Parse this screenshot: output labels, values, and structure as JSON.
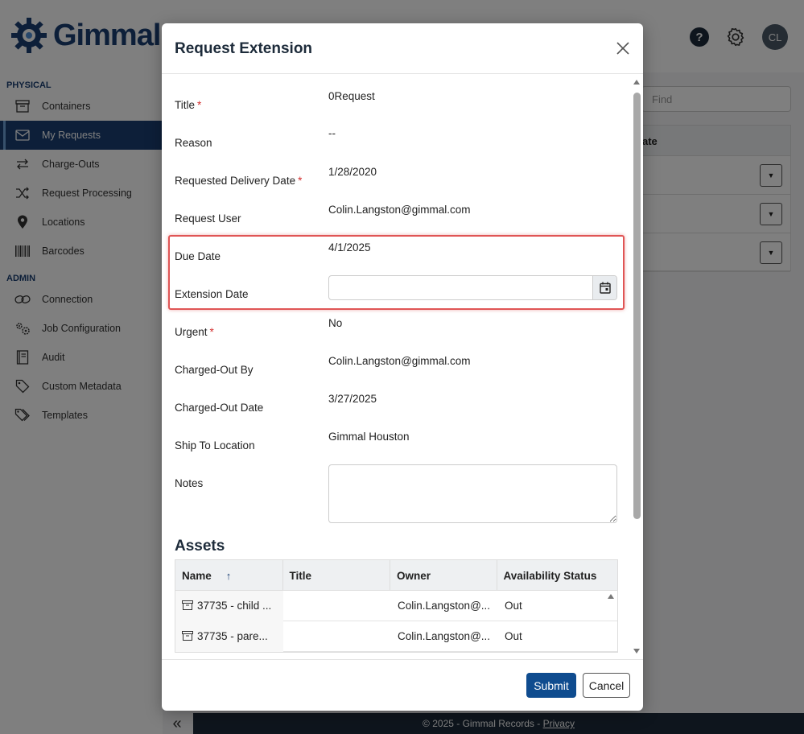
{
  "app": {
    "brand": "Gimmal",
    "avatar_initials": "CL",
    "help_label": "?",
    "find_placeholder": "Find",
    "bg_table_header": "ate",
    "footer_text": "© 2025 - Gimmal Records - ",
    "footer_link": "Privacy",
    "collapse_glyph": "«"
  },
  "sidebar": {
    "sections": [
      {
        "title": "PHYSICAL",
        "items": [
          {
            "label": "Containers",
            "icon": "archive-icon"
          },
          {
            "label": "My Requests",
            "icon": "mail-icon",
            "active": true
          },
          {
            "label": "Charge-Outs",
            "icon": "swap-icon"
          },
          {
            "label": "Request Processing",
            "icon": "shuffle-icon"
          },
          {
            "label": "Locations",
            "icon": "map-pin-icon"
          },
          {
            "label": "Barcodes",
            "icon": "barcode-icon"
          }
        ]
      },
      {
        "title": "ADMIN",
        "items": [
          {
            "label": "Connection",
            "icon": "link-icon"
          },
          {
            "label": "Job Configuration",
            "icon": "gears-icon"
          },
          {
            "label": "Audit",
            "icon": "book-icon"
          },
          {
            "label": "Custom Metadata",
            "icon": "tag-icon"
          },
          {
            "label": "Templates",
            "icon": "tags-icon"
          }
        ]
      }
    ]
  },
  "modal": {
    "title": "Request Extension",
    "fields": {
      "title_label": "Title",
      "title_value": "0Request",
      "reason_label": "Reason",
      "reason_value": "--",
      "delivery_label": "Requested Delivery Date",
      "delivery_value": "1/28/2020",
      "user_label": "Request User",
      "user_value": "Colin.Langston@gimmal.com",
      "due_label": "Due Date",
      "due_value": "4/1/2025",
      "extension_label": "Extension Date",
      "extension_value": "",
      "urgent_label": "Urgent",
      "urgent_value": "No",
      "charged_by_label": "Charged-Out By",
      "charged_by_value": "Colin.Langston@gimmal.com",
      "charged_date_label": "Charged-Out Date",
      "charged_date_value": "3/27/2025",
      "ship_label": "Ship To Location",
      "ship_value": "Gimmal Houston",
      "notes_label": "Notes",
      "notes_value": "",
      "required_mark": "*"
    },
    "assets": {
      "heading": "Assets",
      "columns": [
        "Name",
        "Title",
        "Owner",
        "Availability Status"
      ],
      "sort_glyph": "↑",
      "rows": [
        {
          "name": "37735 - child ...",
          "title": "",
          "owner": "Colin.Langston@...",
          "status": "Out"
        },
        {
          "name": "37735 - pare...",
          "title": "",
          "owner": "Colin.Langston@...",
          "status": "Out"
        }
      ]
    },
    "submit_label": "Submit",
    "cancel_label": "Cancel"
  }
}
